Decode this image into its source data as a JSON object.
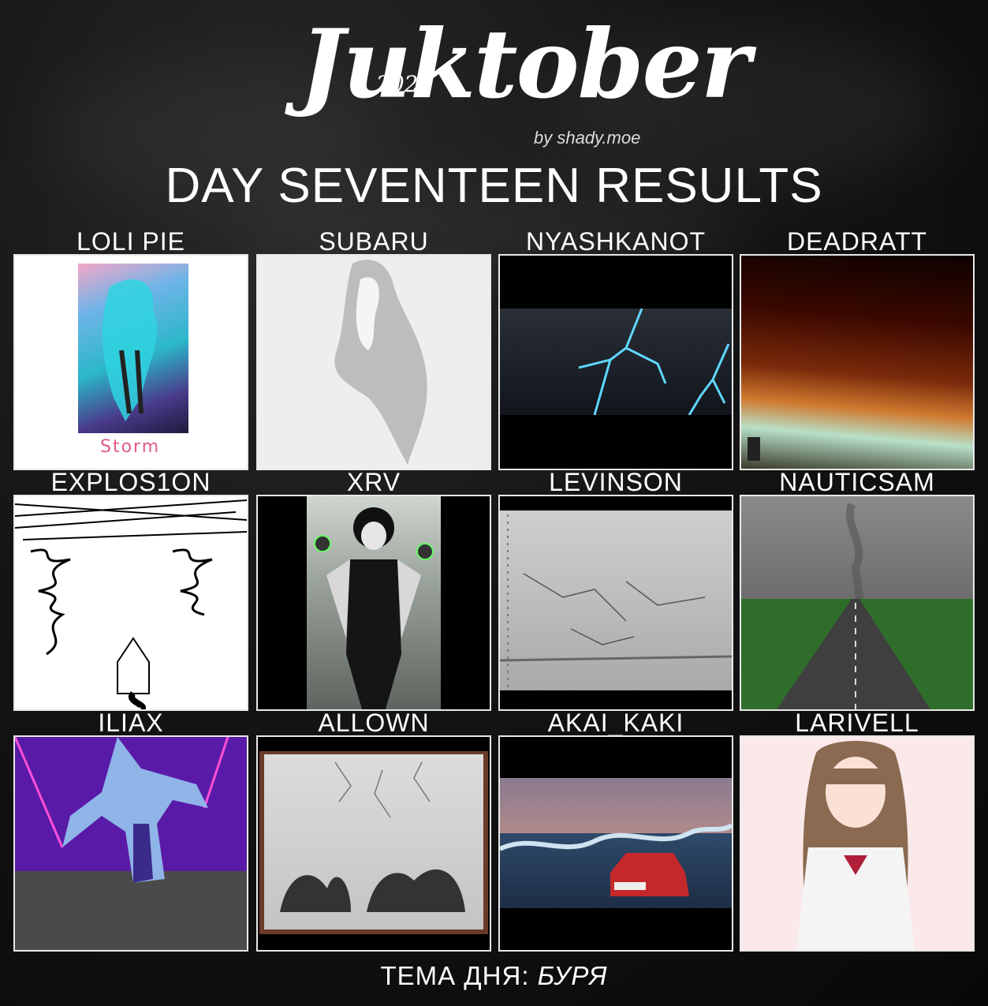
{
  "header": {
    "logo_year": "2020",
    "logo_title": "Juktober",
    "logo_byline": "by shady.moe",
    "title": "DAY SEVENTEEN RESULTS"
  },
  "entries": [
    {
      "name": "LOLI PIE",
      "caption": "Storm"
    },
    {
      "name": "SUBARU"
    },
    {
      "name": "NYASHKANOT"
    },
    {
      "name": "DEADRATT"
    },
    {
      "name": "EXPLOS1ON"
    },
    {
      "name": "XRV"
    },
    {
      "name": "LEVINSON"
    },
    {
      "name": "NAUTICSAM"
    },
    {
      "name": "ILIAX"
    },
    {
      "name": "ALLOWN"
    },
    {
      "name": "AKAI_KAKI"
    },
    {
      "name": "LARIVELL"
    }
  ],
  "footer": {
    "label": "ТЕМА ДНЯ:",
    "topic": "БУРЯ"
  }
}
